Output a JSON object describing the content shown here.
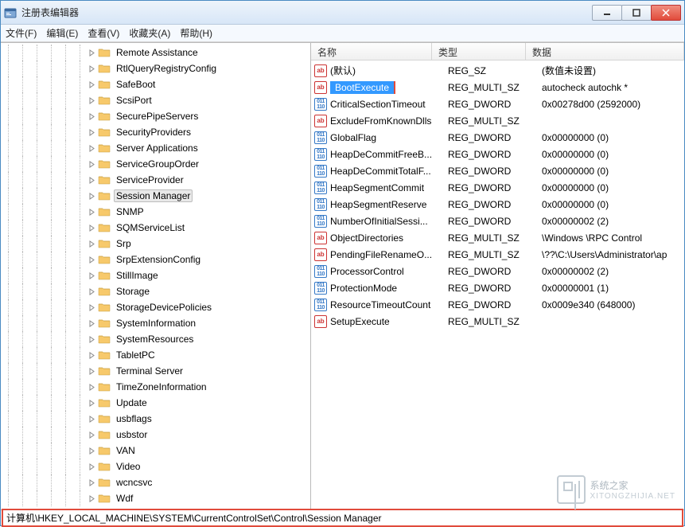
{
  "window": {
    "title": "注册表编辑器"
  },
  "menu": {
    "file": "文件(F)",
    "edit": "编辑(E)",
    "view": "查看(V)",
    "favorites": "收藏夹(A)",
    "help": "帮助(H)"
  },
  "tree": {
    "selected": "Session Manager",
    "items": [
      {
        "label": "Remote Assistance",
        "expanded": false
      },
      {
        "label": "RtlQueryRegistryConfig",
        "expanded": false
      },
      {
        "label": "SafeBoot",
        "expanded": false
      },
      {
        "label": "ScsiPort",
        "expanded": false
      },
      {
        "label": "SecurePipeServers",
        "expanded": false
      },
      {
        "label": "SecurityProviders",
        "expanded": false
      },
      {
        "label": "Server Applications",
        "expanded": false
      },
      {
        "label": "ServiceGroupOrder",
        "expanded": false
      },
      {
        "label": "ServiceProvider",
        "expanded": false
      },
      {
        "label": "Session Manager",
        "expanded": false,
        "selected": true
      },
      {
        "label": "SNMP",
        "expanded": false
      },
      {
        "label": "SQMServiceList",
        "expanded": false
      },
      {
        "label": "Srp",
        "expanded": false
      },
      {
        "label": "SrpExtensionConfig",
        "expanded": false
      },
      {
        "label": "StillImage",
        "expanded": false
      },
      {
        "label": "Storage",
        "expanded": false
      },
      {
        "label": "StorageDevicePolicies",
        "expanded": false
      },
      {
        "label": "SystemInformation",
        "expanded": false
      },
      {
        "label": "SystemResources",
        "expanded": false
      },
      {
        "label": "TabletPC",
        "expanded": false
      },
      {
        "label": "Terminal Server",
        "expanded": false
      },
      {
        "label": "TimeZoneInformation",
        "expanded": false
      },
      {
        "label": "Update",
        "expanded": false
      },
      {
        "label": "usbflags",
        "expanded": false
      },
      {
        "label": "usbstor",
        "expanded": false
      },
      {
        "label": "VAN",
        "expanded": false
      },
      {
        "label": "Video",
        "expanded": false
      },
      {
        "label": "wcncsvc",
        "expanded": false
      },
      {
        "label": "Wdf",
        "expanded": false
      }
    ]
  },
  "list": {
    "headers": {
      "name": "名称",
      "type": "类型",
      "data": "数据"
    },
    "selected": "BootExecute",
    "values": [
      {
        "name": "(默认)",
        "type": "REG_SZ",
        "data": "(数值未设置)",
        "icon": "ab"
      },
      {
        "name": "BootExecute",
        "type": "REG_MULTI_SZ",
        "data": "autocheck autochk *",
        "icon": "ab",
        "selected": true,
        "highlighted": true
      },
      {
        "name": "CriticalSectionTimeout",
        "type": "REG_DWORD",
        "data": "0x00278d00 (2592000)",
        "icon": "bin"
      },
      {
        "name": "ExcludeFromKnownDlls",
        "type": "REG_MULTI_SZ",
        "data": "",
        "icon": "ab"
      },
      {
        "name": "GlobalFlag",
        "type": "REG_DWORD",
        "data": "0x00000000 (0)",
        "icon": "bin"
      },
      {
        "name": "HeapDeCommitFreeB...",
        "type": "REG_DWORD",
        "data": "0x00000000 (0)",
        "icon": "bin"
      },
      {
        "name": "HeapDeCommitTotalF...",
        "type": "REG_DWORD",
        "data": "0x00000000 (0)",
        "icon": "bin"
      },
      {
        "name": "HeapSegmentCommit",
        "type": "REG_DWORD",
        "data": "0x00000000 (0)",
        "icon": "bin"
      },
      {
        "name": "HeapSegmentReserve",
        "type": "REG_DWORD",
        "data": "0x00000000 (0)",
        "icon": "bin"
      },
      {
        "name": "NumberOfInitialSessi...",
        "type": "REG_DWORD",
        "data": "0x00000002 (2)",
        "icon": "bin"
      },
      {
        "name": "ObjectDirectories",
        "type": "REG_MULTI_SZ",
        "data": "\\Windows \\RPC Control",
        "icon": "ab"
      },
      {
        "name": "PendingFileRenameO...",
        "type": "REG_MULTI_SZ",
        "data": "\\??\\C:\\Users\\Administrator\\ap",
        "icon": "ab"
      },
      {
        "name": "ProcessorControl",
        "type": "REG_DWORD",
        "data": "0x00000002 (2)",
        "icon": "bin"
      },
      {
        "name": "ProtectionMode",
        "type": "REG_DWORD",
        "data": "0x00000001 (1)",
        "icon": "bin"
      },
      {
        "name": "ResourceTimeoutCount",
        "type": "REG_DWORD",
        "data": "0x0009e340 (648000)",
        "icon": "bin"
      },
      {
        "name": "SetupExecute",
        "type": "REG_MULTI_SZ",
        "data": "",
        "icon": "ab"
      }
    ]
  },
  "statusbar": {
    "path": "计算机\\HKEY_LOCAL_MACHINE\\SYSTEM\\CurrentControlSet\\Control\\Session Manager"
  },
  "watermark": {
    "brand": "系统之家",
    "sub": "XITONGZHIJIA.NET"
  }
}
